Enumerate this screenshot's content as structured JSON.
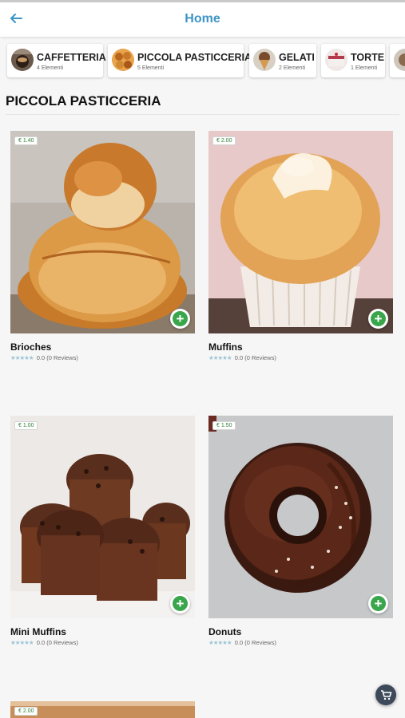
{
  "header": {
    "title": "Home",
    "back_icon": "arrow-left-icon",
    "accent": "#3d94c7"
  },
  "categories": [
    {
      "name": "CAFFETTERIA",
      "count": "4 Elementi"
    },
    {
      "name": "PICCOLA PASTICCERIA",
      "count": "5 Elementi"
    },
    {
      "name": "GELATI",
      "count": "2 Elementi"
    },
    {
      "name": "TORTE",
      "count": "1 Elementi"
    }
  ],
  "section": {
    "title": "PICCOLA PASTICCERIA"
  },
  "products": [
    {
      "name": "Brioches",
      "price": "€ 1.40",
      "rating": "0.0",
      "reviews": "(0 Reviews)"
    },
    {
      "name": "Muffins",
      "price": "€ 2.00",
      "rating": "0.0",
      "reviews": "(0 Reviews)"
    },
    {
      "name": "Mini Muffins",
      "price": "€ 1.00",
      "rating": "0.0",
      "reviews": "(0 Reviews)"
    },
    {
      "name": "Donuts",
      "price": "€ 1.50",
      "rating": "0.0",
      "reviews": "(0 Reviews)"
    },
    {
      "price": "€ 2.00"
    }
  ],
  "ui": {
    "stars": "★★★★★",
    "add_icon": "plus-icon",
    "cart_icon": "shopping-cart-icon",
    "add_color": "#3aa64c"
  }
}
